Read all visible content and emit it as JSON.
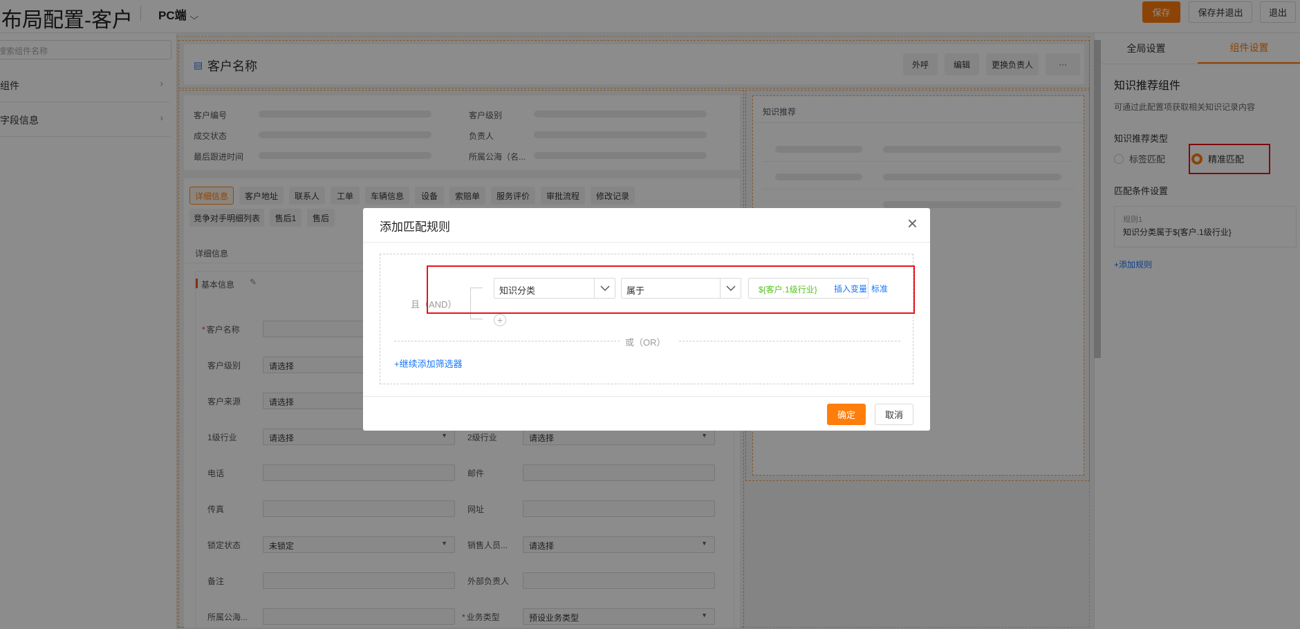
{
  "topbar": {
    "title": "布局配置-客户",
    "platform": "PC端",
    "save": "保存",
    "save_exit": "保存并退出",
    "exit": "退出"
  },
  "sidebar": {
    "search_placeholder": "搜索组件名称",
    "items": [
      {
        "label": "组件"
      },
      {
        "label": "字段信息"
      }
    ]
  },
  "header_card": {
    "title": "客户名称",
    "buttons": [
      "外呼",
      "编辑",
      "更换负责人",
      "···"
    ]
  },
  "summary": {
    "left_labels": [
      "客户编号",
      "成交状态",
      "最后跟进时间"
    ],
    "right_labels": [
      "客户级别",
      "负责人",
      "所属公海（名..."
    ]
  },
  "tabs": [
    "详细信息",
    "客户地址",
    "联系人",
    "工单",
    "车辆信息",
    "设备",
    "索赔单",
    "服务评价",
    "审批流程",
    "修改记录",
    "竞争对手明细列表",
    "售后1",
    "售后"
  ],
  "detail": {
    "section_title": "详细信息",
    "group_title": "基本信息",
    "fields_left": [
      {
        "label": "客户名称",
        "value": "",
        "required": true
      },
      {
        "label": "客户级别",
        "value": "请选择"
      },
      {
        "label": "客户来源",
        "value": "请选择"
      },
      {
        "label": "1级行业",
        "value": "请选择"
      },
      {
        "label": "电话",
        "value": ""
      },
      {
        "label": "传真",
        "value": ""
      },
      {
        "label": "锁定状态",
        "value": "未锁定"
      },
      {
        "label": "备注",
        "value": ""
      },
      {
        "label": "所属公海...",
        "value": ""
      }
    ],
    "fields_right": [
      {
        "label": "2级行业",
        "value": "请选择"
      },
      {
        "label": "邮件",
        "value": ""
      },
      {
        "label": "网址",
        "value": ""
      },
      {
        "label": "销售人员...",
        "value": "请选择"
      },
      {
        "label": "外部负责人",
        "value": ""
      },
      {
        "label": "业务类型",
        "value": "预设业务类型",
        "required": true
      }
    ]
  },
  "knowledge_card": {
    "title": "知识推荐"
  },
  "right_panel": {
    "tabs": [
      "全局设置",
      "组件设置"
    ],
    "active_tab": 1,
    "component_title": "知识推荐组件",
    "description": "可通过此配置项获取相关知识记录内容",
    "type_label": "知识推荐类型",
    "options": [
      "标签匹配",
      "精准匹配"
    ],
    "selected_option": 1,
    "condition_label": "匹配条件设置",
    "rule": {
      "name": "规则1",
      "text": "知识分类属于${客户.1级行业}"
    },
    "add_rule": "+添加规则"
  },
  "modal": {
    "title": "添加匹配规则",
    "and_label": "且（AND）",
    "field_select": "知识分类",
    "operator_select": "属于",
    "value": "${客户.1级行业}",
    "insert_var": "插入变量",
    "standard": "标准",
    "or_label": "或（OR）",
    "add_filter": "+继续添加筛选器",
    "confirm": "确定",
    "cancel": "取消"
  },
  "colors": {
    "accent": "#ff7d0b",
    "link": "#1677ff",
    "highlight": "#e6131b",
    "variable": "#52c41a"
  }
}
